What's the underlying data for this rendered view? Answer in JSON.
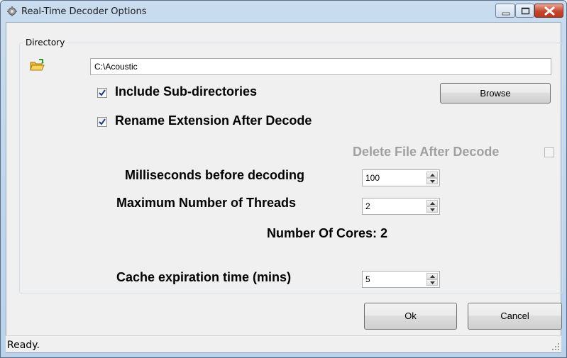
{
  "window": {
    "title": "Real-Time Decoder Options"
  },
  "directory_group": {
    "label": "Directory",
    "path_value": "C:\\Acoustic",
    "browse_label": "Browse"
  },
  "options": {
    "include_subdirs": {
      "label": "Include Sub-directories",
      "checked": true
    },
    "rename_extension": {
      "label": "Rename Extension After Decode",
      "checked": true
    },
    "delete_file": {
      "label": "Delete File After Decode",
      "checked": false,
      "enabled": false
    }
  },
  "fields": {
    "milliseconds": {
      "label": "Milliseconds before decoding",
      "value": "100"
    },
    "threads": {
      "label": "Maximum Number of Threads",
      "value": "2"
    },
    "cores": {
      "label": "Number Of Cores:",
      "value": "2"
    },
    "cache": {
      "label": "Cache expiration time (mins)",
      "value": "5"
    }
  },
  "buttons": {
    "ok": "Ok",
    "cancel": "Cancel"
  },
  "status": {
    "text": "Ready."
  },
  "icons": {
    "app": "gear-icon",
    "folder": "open-folder-icon",
    "minimize": "minimize-icon",
    "maximize": "maximize-icon",
    "close": "close-icon",
    "check": "checkmark-icon",
    "spin_up": "spin-up-icon",
    "spin_down": "spin-down-icon",
    "grip": "resize-grip-icon"
  },
  "colors": {
    "titlebar": "#c9dcef",
    "close_button": "#c4462f",
    "disabled_text": "#a0a0a0"
  }
}
